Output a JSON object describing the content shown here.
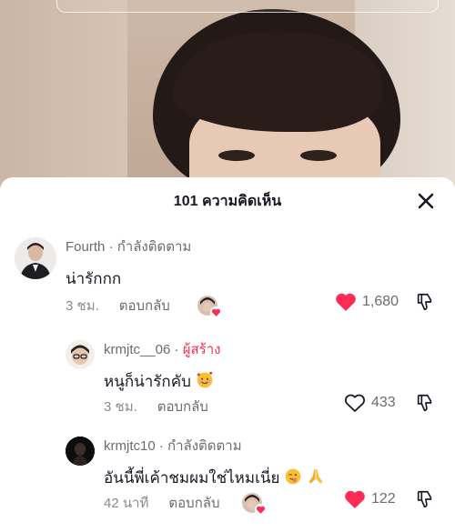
{
  "sheet": {
    "title": "101 ความคิดเห็น"
  },
  "comments": [
    {
      "username": "Fourth",
      "separator": " · ",
      "relation": "กำลังติดตาม",
      "text": "น่ารักกก",
      "time": "3 ชม.",
      "reply_label": "ตอบกลับ",
      "likes": "1,680",
      "liked": true,
      "creator_liked": true
    },
    {
      "username": "krmjtc__06",
      "separator": " · ",
      "relation": "ผู้สร้าง",
      "text": "หนูก็น่ารักคับ",
      "emoji": "smiling-face-with-hearts",
      "time": "3 ชม.",
      "reply_label": "ตอบกลับ",
      "likes": "433",
      "liked": false
    },
    {
      "username": "krmjtc10",
      "separator": " · ",
      "relation": "กำลังติดตาม",
      "text": "อันนี้พี่เค้าชมผมใช่ไหมเนี่ย",
      "emojis": [
        "winking-face-with-tongue",
        "folded-hands"
      ],
      "time": "42 นาที",
      "reply_label": "ตอบกลับ",
      "likes": "122",
      "liked": true,
      "creator_liked": true
    }
  ],
  "colors": {
    "heart_red": "#fe2c55",
    "creator_label": "#fe2c55",
    "muted_text": "#6b6b72"
  }
}
